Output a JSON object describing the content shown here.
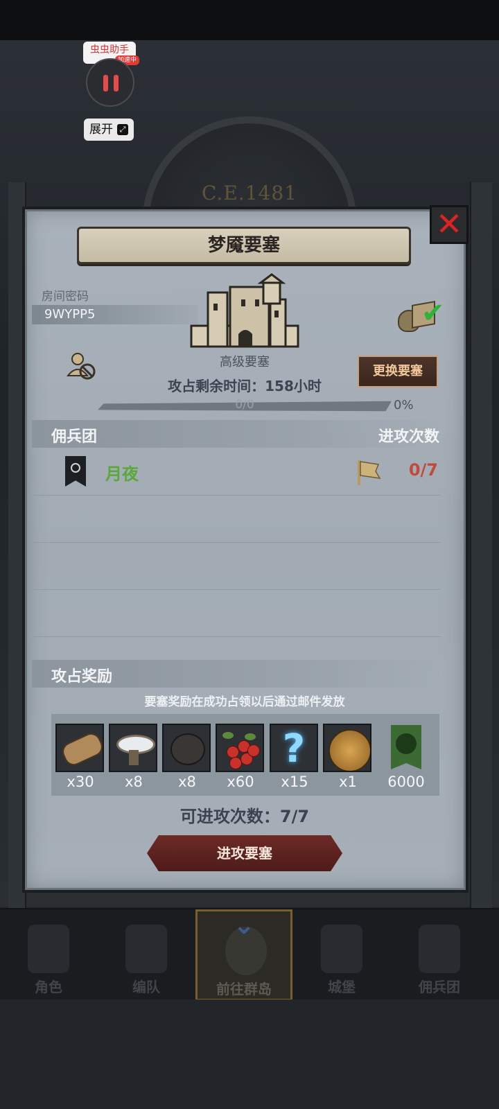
{
  "overlay": {
    "app_label": "虫虫助手",
    "badge": "加速中",
    "expand_label": "展开"
  },
  "background": {
    "era": "C.E.1481"
  },
  "modal": {
    "title": "梦魇要塞",
    "room_label": "房间密码",
    "room_code": "9WYPP5",
    "fortress_level": "高级要塞",
    "change_button": "更换要塞",
    "remaining_time": "攻占剩余时间：158小时",
    "progress_text": "0/0",
    "progress_fraction": 0,
    "progress_percent": "0%",
    "mercenary_header": "佣兵团",
    "attacks_header": "进攻次数",
    "mercenaries": [
      {
        "name": "月夜",
        "attacks": "0/7"
      }
    ],
    "reward_header": "攻占奖励",
    "reward_note": "要塞奖励在成功占领以后通过邮件发放",
    "rewards": [
      {
        "icon": "log-icon",
        "qty": "x30"
      },
      {
        "icon": "bowl-icon",
        "qty": "x8"
      },
      {
        "icon": "truffle-icon",
        "qty": "x8"
      },
      {
        "icon": "berries-icon",
        "qty": "x60"
      },
      {
        "icon": "mystery-icon",
        "qty": "x15"
      },
      {
        "icon": "helmet-coin-icon",
        "qty": "x1"
      },
      {
        "icon": "guild-banner-icon",
        "qty": "6000"
      }
    ],
    "attack_remaining": "可进攻次数：7/7",
    "attack_button": "进攻要塞"
  },
  "nav": {
    "items": [
      {
        "label": "角色",
        "icon": "knight-icon"
      },
      {
        "label": "编队",
        "icon": "helmet-icon"
      },
      {
        "label": "前往群岛",
        "icon": "globe-icon",
        "active": true
      },
      {
        "label": "城堡",
        "icon": "castle-icon"
      },
      {
        "label": "佣兵团",
        "icon": "banner-tower-icon"
      }
    ]
  },
  "colors": {
    "merc_name": "#5aa83a",
    "attack_count": "#c24a3b",
    "close": "#dd2222",
    "change_button_text": "#f2c79a"
  }
}
